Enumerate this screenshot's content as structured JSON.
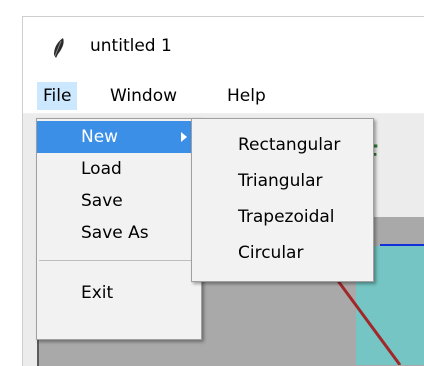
{
  "window": {
    "title": "untitled 1"
  },
  "menubar": {
    "items": [
      {
        "label": "File"
      },
      {
        "label": "Window"
      },
      {
        "label": "Help"
      }
    ]
  },
  "file_menu": {
    "items": [
      {
        "label": "New"
      },
      {
        "label": "Load"
      },
      {
        "label": "Save"
      },
      {
        "label": "Save As"
      },
      {
        "label": "Exit"
      }
    ]
  },
  "new_submenu": {
    "items": [
      {
        "label": "Rectangular"
      },
      {
        "label": "Triangular"
      },
      {
        "label": "Trapezoidal"
      },
      {
        "label": "Circular"
      }
    ]
  },
  "content": {
    "partial_heading": "of"
  },
  "colors": {
    "menu_highlight": "#3b8fe6",
    "menubar_open": "#cce8ff",
    "heading_green": "#2f7d2f"
  },
  "icons": {
    "app_icon": "feather-icon",
    "submenu_arrow": "chevron-right-icon"
  }
}
